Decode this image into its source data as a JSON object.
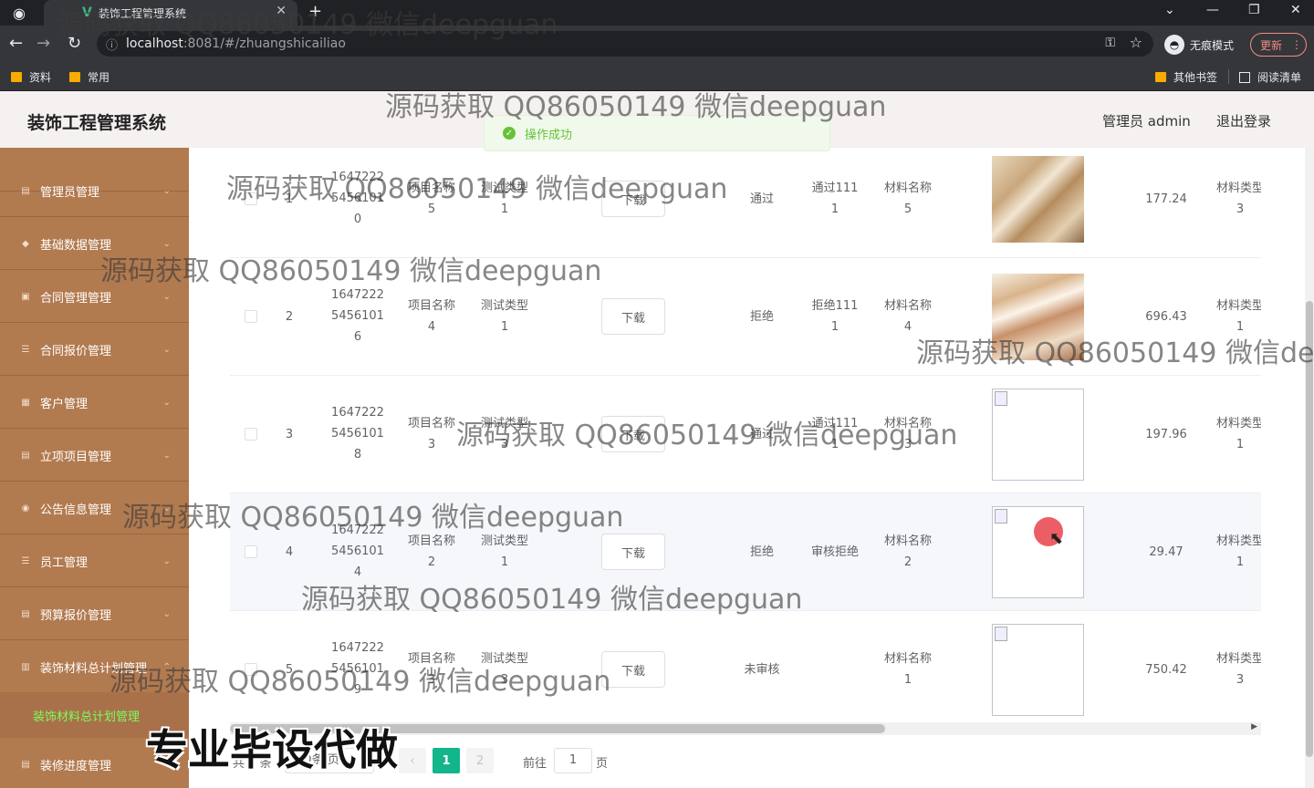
{
  "browser": {
    "tab_title": "装饰工程管理系统",
    "url_host": "localhost",
    "url_path": ":8081/#/zhuangshicailiao",
    "incognito_label": "无痕模式",
    "update_label": "更新",
    "bookmarks": [
      "资料",
      "常用"
    ],
    "bookmarks_right": [
      "其他书签",
      "阅读清单"
    ]
  },
  "header": {
    "title": "装饰工程管理系统",
    "user": "管理员 admin",
    "logout": "退出登录"
  },
  "toast": "操作成功",
  "sidebar": {
    "items": [
      "管理员管理",
      "基础数据管理",
      "合同管理管理",
      "合同报价管理",
      "客户管理",
      "立项项目管理",
      "公告信息管理",
      "员工管理",
      "预算报价管理",
      "装饰材料总计划管理"
    ],
    "sub_item": "装饰材料总计划管理",
    "last_item": "装修进度管理"
  },
  "table": {
    "download_label": "下载",
    "rows": [
      {
        "idx": "1",
        "code": [
          "1647222",
          "5456101",
          "0"
        ],
        "project": [
          "项目名称",
          "5"
        ],
        "type": [
          "测试类型",
          "1"
        ],
        "status": "通过",
        "remark": [
          "通过111",
          "1"
        ],
        "material": [
          "材料名称",
          "5"
        ],
        "image": "photo",
        "price": "177.24",
        "mtype": [
          "材料类型",
          "3"
        ]
      },
      {
        "idx": "2",
        "code": [
          "1647222",
          "5456101",
          "6"
        ],
        "project": [
          "项目名称",
          "4"
        ],
        "type": [
          "测试类型",
          "1"
        ],
        "status": "拒绝",
        "remark": [
          "拒绝111",
          "1"
        ],
        "material": [
          "材料名称",
          "4"
        ],
        "image": "photo",
        "price": "696.43",
        "mtype": [
          "材料类型",
          "1"
        ]
      },
      {
        "idx": "3",
        "code": [
          "1647222",
          "5456101",
          "8"
        ],
        "project": [
          "项目名称",
          "3"
        ],
        "type": [
          "测试类型",
          "3"
        ],
        "status": "通过",
        "remark": [
          "通过111",
          "1"
        ],
        "material": [
          "材料名称",
          "3"
        ],
        "image": "broken",
        "price": "197.96",
        "mtype": [
          "材料类型",
          "1"
        ]
      },
      {
        "idx": "4",
        "code": [
          "1647222",
          "5456101",
          "4"
        ],
        "project": [
          "项目名称",
          "2"
        ],
        "type": [
          "测试类型",
          "1"
        ],
        "status": "拒绝",
        "remark": [
          "审核拒绝",
          ""
        ],
        "material": [
          "材料名称",
          "2"
        ],
        "image": "broken",
        "price": "29.47",
        "mtype": [
          "材料类型",
          "1"
        ]
      },
      {
        "idx": "5",
        "code": [
          "1647222",
          "5456101",
          "9"
        ],
        "project": [
          "项目名称",
          "3"
        ],
        "type": [
          "测试类型",
          "3"
        ],
        "status": "未审核",
        "remark": [
          "",
          ""
        ],
        "material": [
          "材料名称",
          "1"
        ],
        "image": "broken",
        "price": "750.42",
        "mtype": [
          "材料类型",
          "3"
        ]
      }
    ]
  },
  "pagination": {
    "total": "共 5 条",
    "page_size": "10条/页",
    "current": "1",
    "next": "2",
    "goto_label": "前往",
    "goto_value": "1",
    "unit": "页"
  },
  "watermark": "源码获取 QQ86050149 微信deepguan",
  "watermark_big": "专业毕设代做"
}
